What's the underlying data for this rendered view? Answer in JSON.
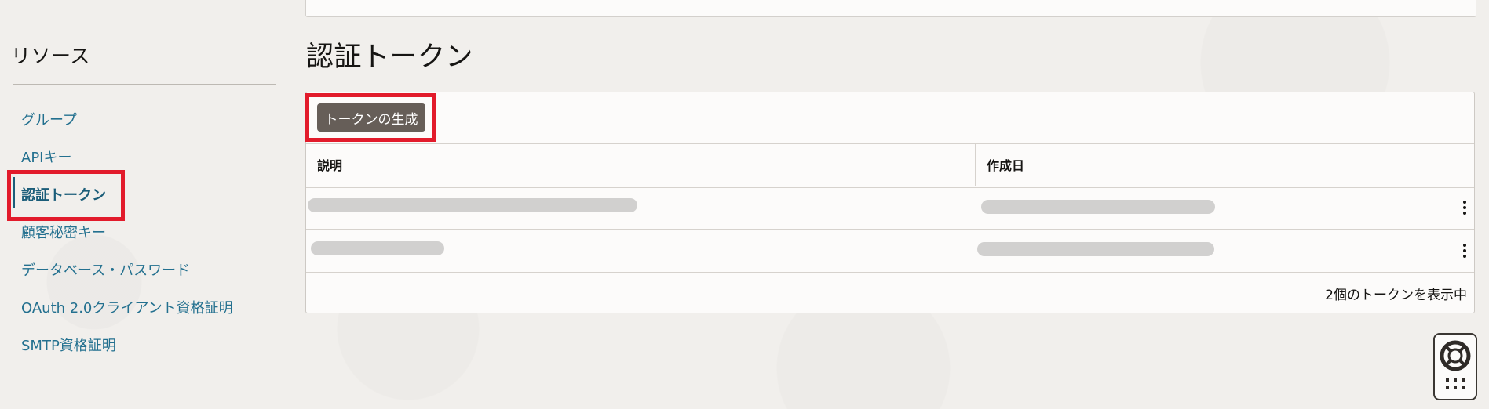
{
  "sidebar": {
    "title": "リソース",
    "items": [
      {
        "label": "グループ"
      },
      {
        "label": "APIキー"
      },
      {
        "label": "認証トークン"
      },
      {
        "label": "顧客秘密キー"
      },
      {
        "label": "データベース・パスワード"
      },
      {
        "label": "OAuth 2.0クライアント資格証明"
      },
      {
        "label": "SMTP資格証明"
      }
    ],
    "active_index": 2
  },
  "main": {
    "title": "認証トークン",
    "generate_button": "トークンの生成",
    "table": {
      "columns": [
        "説明",
        "作成日"
      ],
      "rows": [
        {
          "description": "",
          "created": ""
        },
        {
          "description": "",
          "created": ""
        }
      ]
    },
    "footer": "2個のトークンを表示中"
  },
  "colors": {
    "link": "#23708f",
    "button": "#665e58",
    "highlight": "#e21b2b"
  }
}
